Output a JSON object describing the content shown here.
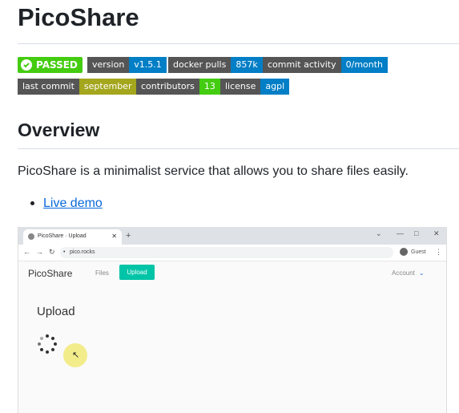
{
  "page": {
    "title": "PicoShare",
    "overview_heading": "Overview",
    "description": "PicoShare is a minimalist service that allows you to share files easily.",
    "links": [
      {
        "label": "Live demo"
      }
    ]
  },
  "badges": {
    "passed": {
      "label": "PASSED",
      "color": "#44cc11"
    },
    "items": [
      {
        "left": "version",
        "right": "v1.5.1",
        "color": "#007ec6"
      },
      {
        "left": "docker pulls",
        "right": "857k",
        "color": "#007ec6"
      },
      {
        "left": "commit activity",
        "right": "0/month",
        "color": "#007ec6"
      },
      {
        "left": "last commit",
        "right": "september",
        "color": "#a4a61d"
      },
      {
        "left": "contributors",
        "right": "13",
        "color": "#4c1"
      },
      {
        "left": "license",
        "right": "agpl",
        "color": "#007ec6"
      }
    ]
  },
  "screenshot": {
    "tab_title": "PicoShare · Upload",
    "url": "pico.rocks",
    "profile": "Guest",
    "brand": "PicoShare",
    "nav_files": "Files",
    "nav_upload": "Upload",
    "account": "Account",
    "upload_heading": "Upload",
    "icons": [
      "favicon-icon",
      "close-icon",
      "plus-icon",
      "back-icon",
      "forward-icon",
      "reload-icon",
      "lock-icon",
      "profile-icon",
      "kebab-icon",
      "spinner-icon",
      "cursor-icon"
    ]
  }
}
